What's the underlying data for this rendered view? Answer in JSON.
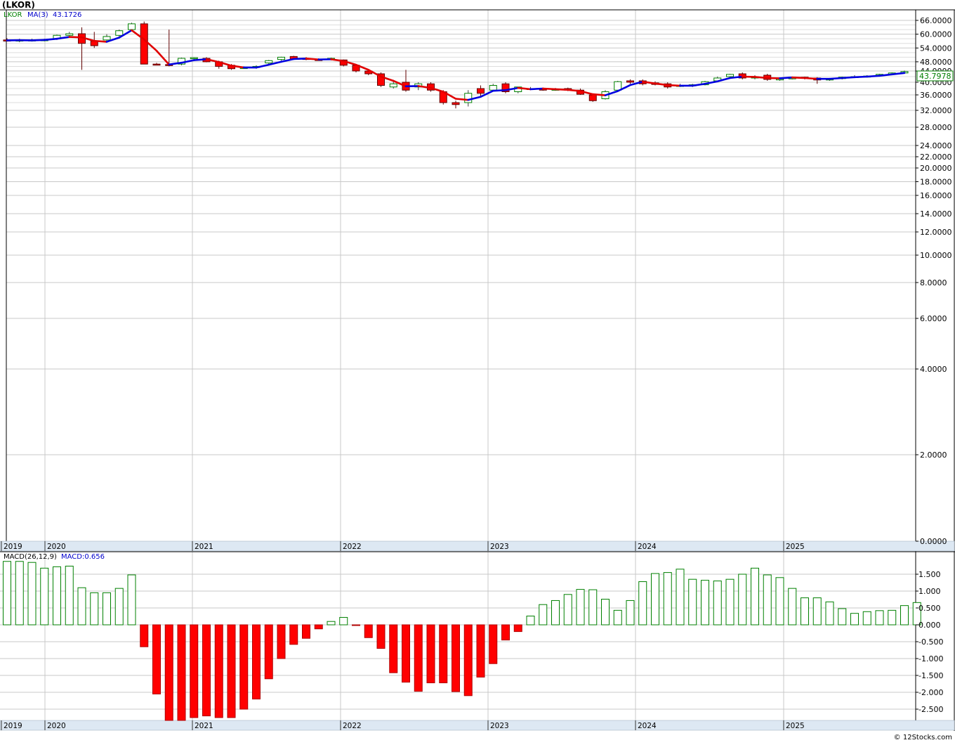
{
  "header": {
    "title": "(LKOR)"
  },
  "legend": {
    "symbol": "LKOR",
    "ma_label": "MA(3)",
    "ma_value": "43.1726"
  },
  "macd_legend": {
    "label": "MACD(26,12,9)",
    "value": "MACD:0.656"
  },
  "last_price": "43.7978",
  "footer": {
    "credit": "© 12Stocks.com"
  },
  "colors": {
    "up": "#008000",
    "down": "#ff0000",
    "ma_up": "#0000e0",
    "ma_down": "#e00000",
    "timeline_bg": "#dde8f3"
  },
  "chart_data": [
    {
      "type": "candlestick",
      "title": "(LKOR)",
      "scale": "log",
      "y_ticks": [
        "66.0000",
        "60.0000",
        "54.0000",
        "48.0000",
        "44.0000",
        "40.0000",
        "36.0000",
        "32.0000",
        "28.0000",
        "24.0000",
        "22.0000",
        "20.0000",
        "18.0000",
        "16.0000",
        "14.0000",
        "12.0000",
        "10.0000",
        "8.0000",
        "6.0000",
        "4.0000",
        "2.0000",
        "0.0000"
      ],
      "x_ticks": [
        "2019",
        "2020",
        "2021",
        "2022",
        "2023",
        "2024",
        "2025"
      ],
      "candles": [
        {
          "o": 57.5,
          "h": 58.2,
          "l": 56.8,
          "c": 57.0
        },
        {
          "o": 57.0,
          "h": 58.0,
          "l": 56.5,
          "c": 57.5
        },
        {
          "o": 57.5,
          "h": 58.0,
          "l": 56.8,
          "c": 57.5
        },
        {
          "o": 57.5,
          "h": 58.0,
          "l": 56.9,
          "c": 57.6
        },
        {
          "o": 58.0,
          "h": 59.8,
          "l": 57.5,
          "c": 59.5
        },
        {
          "o": 59.5,
          "h": 61.0,
          "l": 59.0,
          "c": 60.2
        },
        {
          "o": 60.2,
          "h": 63.0,
          "l": 44.5,
          "c": 56.0
        },
        {
          "o": 57.0,
          "h": 61.0,
          "l": 54.0,
          "c": 55.0
        },
        {
          "o": 57.5,
          "h": 60.0,
          "l": 56.5,
          "c": 59.0
        },
        {
          "o": 59.5,
          "h": 62.0,
          "l": 59.0,
          "c": 61.5
        },
        {
          "o": 62.0,
          "h": 65.0,
          "l": 61.5,
          "c": 64.5
        },
        {
          "o": 64.5,
          "h": 65.5,
          "l": 47.0,
          "c": 47.0
        },
        {
          "o": 47.0,
          "h": 47.5,
          "l": 46.5,
          "c": 46.8
        },
        {
          "o": 46.8,
          "h": 62.0,
          "l": 46.0,
          "c": 46.5
        },
        {
          "o": 47.0,
          "h": 49.8,
          "l": 46.5,
          "c": 49.5
        },
        {
          "o": 49.5,
          "h": 50.0,
          "l": 49.0,
          "c": 49.8
        },
        {
          "o": 49.5,
          "h": 50.0,
          "l": 47.8,
          "c": 48.0
        },
        {
          "o": 48.0,
          "h": 48.5,
          "l": 45.0,
          "c": 46.0
        },
        {
          "o": 46.5,
          "h": 47.0,
          "l": 44.5,
          "c": 45.0
        },
        {
          "o": 45.5,
          "h": 46.0,
          "l": 45.0,
          "c": 45.5
        },
        {
          "o": 45.5,
          "h": 46.5,
          "l": 45.0,
          "c": 46.0
        },
        {
          "o": 47.5,
          "h": 48.8,
          "l": 47.0,
          "c": 48.5
        },
        {
          "o": 49.0,
          "h": 50.2,
          "l": 48.5,
          "c": 50.0
        },
        {
          "o": 50.3,
          "h": 50.6,
          "l": 49.0,
          "c": 49.2
        },
        {
          "o": 49.5,
          "h": 50.0,
          "l": 48.7,
          "c": 49.0
        },
        {
          "o": 49.0,
          "h": 49.5,
          "l": 48.5,
          "c": 48.8
        },
        {
          "o": 49.0,
          "h": 49.8,
          "l": 48.6,
          "c": 49.5
        },
        {
          "o": 48.8,
          "h": 49.0,
          "l": 46.0,
          "c": 46.5
        },
        {
          "o": 46.5,
          "h": 47.0,
          "l": 43.5,
          "c": 44.0
        },
        {
          "o": 44.0,
          "h": 44.5,
          "l": 42.5,
          "c": 43.0
        },
        {
          "o": 43.0,
          "h": 43.5,
          "l": 38.5,
          "c": 39.0
        },
        {
          "o": 38.5,
          "h": 40.5,
          "l": 38.0,
          "c": 39.5
        },
        {
          "o": 40.0,
          "h": 44.5,
          "l": 37.0,
          "c": 37.5
        },
        {
          "o": 38.5,
          "h": 40.0,
          "l": 37.5,
          "c": 39.5
        },
        {
          "o": 39.5,
          "h": 40.0,
          "l": 37.0,
          "c": 37.5
        },
        {
          "o": 37.0,
          "h": 37.5,
          "l": 33.5,
          "c": 34.0
        },
        {
          "o": 34.0,
          "h": 34.5,
          "l": 32.5,
          "c": 33.5
        },
        {
          "o": 34.0,
          "h": 37.5,
          "l": 33.0,
          "c": 36.5
        },
        {
          "o": 38.0,
          "h": 39.0,
          "l": 35.5,
          "c": 36.5
        },
        {
          "o": 37.5,
          "h": 39.5,
          "l": 37.0,
          "c": 39.0
        },
        {
          "o": 39.5,
          "h": 40.0,
          "l": 36.5,
          "c": 37.0
        },
        {
          "o": 37.0,
          "h": 38.5,
          "l": 36.5,
          "c": 38.5
        },
        {
          "o": 38.0,
          "h": 38.5,
          "l": 37.5,
          "c": 38.0
        },
        {
          "o": 38.0,
          "h": 38.3,
          "l": 37.3,
          "c": 37.5
        },
        {
          "o": 37.8,
          "h": 38.2,
          "l": 37.3,
          "c": 37.8
        },
        {
          "o": 38.0,
          "h": 38.3,
          "l": 37.2,
          "c": 37.5
        },
        {
          "o": 37.5,
          "h": 38.0,
          "l": 36.0,
          "c": 36.2
        },
        {
          "o": 36.0,
          "h": 36.3,
          "l": 34.2,
          "c": 34.5
        },
        {
          "o": 35.0,
          "h": 37.5,
          "l": 34.8,
          "c": 37.0
        },
        {
          "o": 37.5,
          "h": 40.5,
          "l": 37.0,
          "c": 40.2
        },
        {
          "o": 40.5,
          "h": 41.0,
          "l": 39.5,
          "c": 40.0
        },
        {
          "o": 40.5,
          "h": 41.0,
          "l": 39.0,
          "c": 39.5
        },
        {
          "o": 39.8,
          "h": 40.3,
          "l": 39.0,
          "c": 39.3
        },
        {
          "o": 39.5,
          "h": 40.0,
          "l": 38.0,
          "c": 38.5
        },
        {
          "o": 38.8,
          "h": 39.5,
          "l": 38.5,
          "c": 39.0
        },
        {
          "o": 39.0,
          "h": 39.5,
          "l": 38.5,
          "c": 39.2
        },
        {
          "o": 39.2,
          "h": 40.5,
          "l": 39.0,
          "c": 40.2
        },
        {
          "o": 40.5,
          "h": 42.0,
          "l": 40.0,
          "c": 41.5
        },
        {
          "o": 42.0,
          "h": 43.0,
          "l": 41.5,
          "c": 42.8
        },
        {
          "o": 43.0,
          "h": 43.5,
          "l": 41.0,
          "c": 41.5
        },
        {
          "o": 41.5,
          "h": 42.5,
          "l": 41.0,
          "c": 42.0
        },
        {
          "o": 42.5,
          "h": 43.0,
          "l": 40.5,
          "c": 41.0
        },
        {
          "o": 41.0,
          "h": 41.5,
          "l": 40.5,
          "c": 41.2
        },
        {
          "o": 41.2,
          "h": 42.0,
          "l": 41.0,
          "c": 41.8
        },
        {
          "o": 41.8,
          "h": 42.0,
          "l": 41.0,
          "c": 41.5
        },
        {
          "o": 41.5,
          "h": 41.8,
          "l": 39.5,
          "c": 40.8
        },
        {
          "o": 40.8,
          "h": 41.5,
          "l": 40.5,
          "c": 41.3
        },
        {
          "o": 41.3,
          "h": 42.0,
          "l": 41.0,
          "c": 41.8
        },
        {
          "o": 42.0,
          "h": 42.5,
          "l": 41.5,
          "c": 42.0
        },
        {
          "o": 42.0,
          "h": 42.5,
          "l": 41.8,
          "c": 42.2
        },
        {
          "o": 42.3,
          "h": 43.0,
          "l": 42.0,
          "c": 42.8
        },
        {
          "o": 42.8,
          "h": 43.5,
          "l": 42.5,
          "c": 43.3
        },
        {
          "o": 43.3,
          "h": 44.2,
          "l": 43.0,
          "c": 43.8
        }
      ],
      "ma": [
        57.3,
        57.4,
        57.3,
        57.5,
        58.0,
        58.8,
        58.6,
        57.1,
        56.7,
        58.5,
        61.7,
        57.7,
        52.8,
        46.8,
        47.6,
        48.7,
        49.1,
        47.9,
        46.3,
        45.5,
        45.5,
        46.7,
        48.0,
        49.2,
        49.4,
        49.0,
        49.1,
        48.3,
        46.7,
        44.5,
        42.0,
        40.5,
        38.7,
        38.8,
        38.2,
        37.0,
        35.0,
        34.7,
        35.5,
        37.3,
        37.5,
        38.2,
        37.8,
        38.0,
        37.8,
        37.6,
        37.2,
        36.2,
        35.9,
        37.2,
        39.1,
        40.2,
        39.6,
        39.1,
        38.9,
        38.9,
        39.5,
        40.3,
        41.5,
        42.0,
        41.9,
        41.5,
        41.4,
        41.7,
        41.5,
        41.2,
        41.2,
        41.5,
        41.8,
        42.0,
        42.3,
        42.8,
        43.3
      ],
      "ma_trend": [
        "d",
        "u",
        "u",
        "u",
        "u",
        "u",
        "d",
        "d",
        "d",
        "u",
        "u",
        "d",
        "d",
        "d",
        "u",
        "u",
        "u",
        "d",
        "d",
        "d",
        "u",
        "u",
        "u",
        "u",
        "u",
        "d",
        "u",
        "d",
        "d",
        "d",
        "d",
        "d",
        "d",
        "u",
        "d",
        "d",
        "d",
        "d",
        "u",
        "u",
        "u",
        "u",
        "d",
        "u",
        "d",
        "d",
        "d",
        "d",
        "d",
        "u",
        "u",
        "u",
        "d",
        "d",
        "d",
        "u",
        "u",
        "u",
        "u",
        "u",
        "d",
        "d",
        "d",
        "u",
        "d",
        "d",
        "u",
        "u",
        "u",
        "u",
        "u",
        "u",
        "u"
      ],
      "last_price": "43.7978",
      "ma_value": "43.1726"
    },
    {
      "type": "bar",
      "title": "MACD(26,12,9)",
      "y_ticks": [
        "1.500",
        "1.000",
        "0.500",
        "0.000",
        "-0.500",
        "-1.000",
        "-1.500",
        "-2.000",
        "-2.500"
      ],
      "x_ticks": [
        "2019",
        "2020",
        "2021",
        "2022",
        "2023",
        "2024",
        "2025"
      ],
      "values": [
        1.88,
        1.88,
        1.85,
        1.68,
        1.72,
        1.74,
        1.1,
        0.95,
        0.95,
        1.08,
        1.48,
        -0.65,
        -2.05,
        -2.85,
        -2.85,
        -2.75,
        -2.7,
        -2.75,
        -2.75,
        -2.5,
        -2.2,
        -1.6,
        -1.0,
        -0.58,
        -0.4,
        -0.12,
        0.1,
        0.22,
        -0.02,
        -0.38,
        -0.7,
        -1.42,
        -1.7,
        -1.97,
        -1.72,
        -1.72,
        -1.98,
        -2.1,
        -1.55,
        -1.15,
        -0.45,
        -0.2,
        0.26,
        0.6,
        0.72,
        0.9,
        1.05,
        1.04,
        0.76,
        0.43,
        0.72,
        1.28,
        1.52,
        1.55,
        1.65,
        1.35,
        1.32,
        1.3,
        1.35,
        1.5,
        1.68,
        1.48,
        1.4,
        1.08,
        0.8,
        0.8,
        0.68,
        0.48,
        0.34,
        0.39,
        0.42,
        0.43,
        0.57,
        0.66
      ],
      "value_label": "MACD:0.656"
    }
  ]
}
